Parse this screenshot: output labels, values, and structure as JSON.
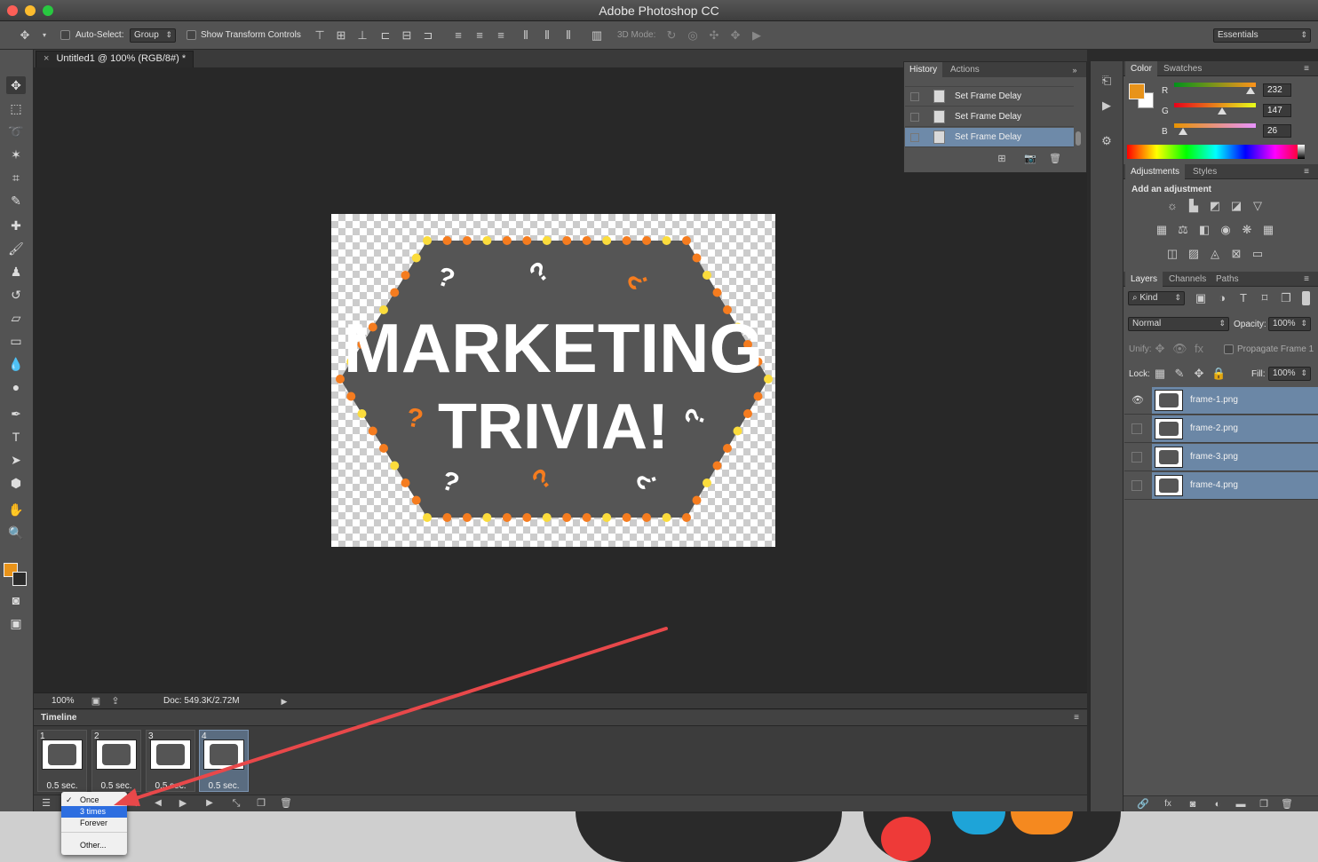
{
  "app": {
    "title": "Adobe Photoshop CC"
  },
  "options_bar": {
    "auto_select_label": "Auto-Select:",
    "auto_select_value": "Group",
    "show_transform_label": "Show Transform Controls",
    "mode_3d_label": "3D Mode:",
    "workspace": "Essentials"
  },
  "document": {
    "tab_title": "Untitled1 @ 100% (RGB/8#) *",
    "zoom": "100%",
    "doc_size": "Doc: 549.3K/2.72M",
    "artwork_line1": "MARKETING",
    "artwork_line2": "TRIVIA!"
  },
  "history": {
    "tabs": [
      "History",
      "Actions"
    ],
    "rows": [
      "Set Frame Delay",
      "Set Frame Delay",
      "Set Frame Delay"
    ]
  },
  "color_panel": {
    "tabs": [
      "Color",
      "Swatches"
    ],
    "foreground": "#e8931a",
    "channels": [
      {
        "name": "R",
        "value": "232"
      },
      {
        "name": "G",
        "value": "147"
      },
      {
        "name": "B",
        "value": "26"
      }
    ]
  },
  "adjustments_panel": {
    "tabs": [
      "Adjustments",
      "Styles"
    ],
    "heading": "Add an adjustment"
  },
  "layers_panel": {
    "tabs": [
      "Layers",
      "Channels",
      "Paths"
    ],
    "kind_label": "Kind",
    "blend_mode": "Normal",
    "opacity_label": "Opacity:",
    "opacity": "100%",
    "unify_label": "Unify:",
    "propagate_label": "Propagate Frame 1",
    "lock_label": "Lock:",
    "fill_label": "Fill:",
    "fill": "100%",
    "layers": [
      "frame-1.png",
      "frame-2.png",
      "frame-3.png",
      "frame-4.png"
    ]
  },
  "timeline": {
    "title": "Timeline",
    "frames": [
      {
        "num": "1",
        "delay": "0.5 sec."
      },
      {
        "num": "2",
        "delay": "0.5 sec."
      },
      {
        "num": "3",
        "delay": "0.5 sec."
      },
      {
        "num": "4",
        "delay": "0.5 sec."
      }
    ]
  },
  "loop_menu": {
    "items": [
      "Once",
      "3 times",
      "Forever",
      "Other..."
    ],
    "checked": "Once",
    "highlighted": "3 times"
  },
  "colors": {
    "accent_orange": "#f57c1f",
    "accent_yellow": "#fbdc3c",
    "selection_blue": "#6b87a6",
    "annotation_arrow": "#e8484a"
  }
}
